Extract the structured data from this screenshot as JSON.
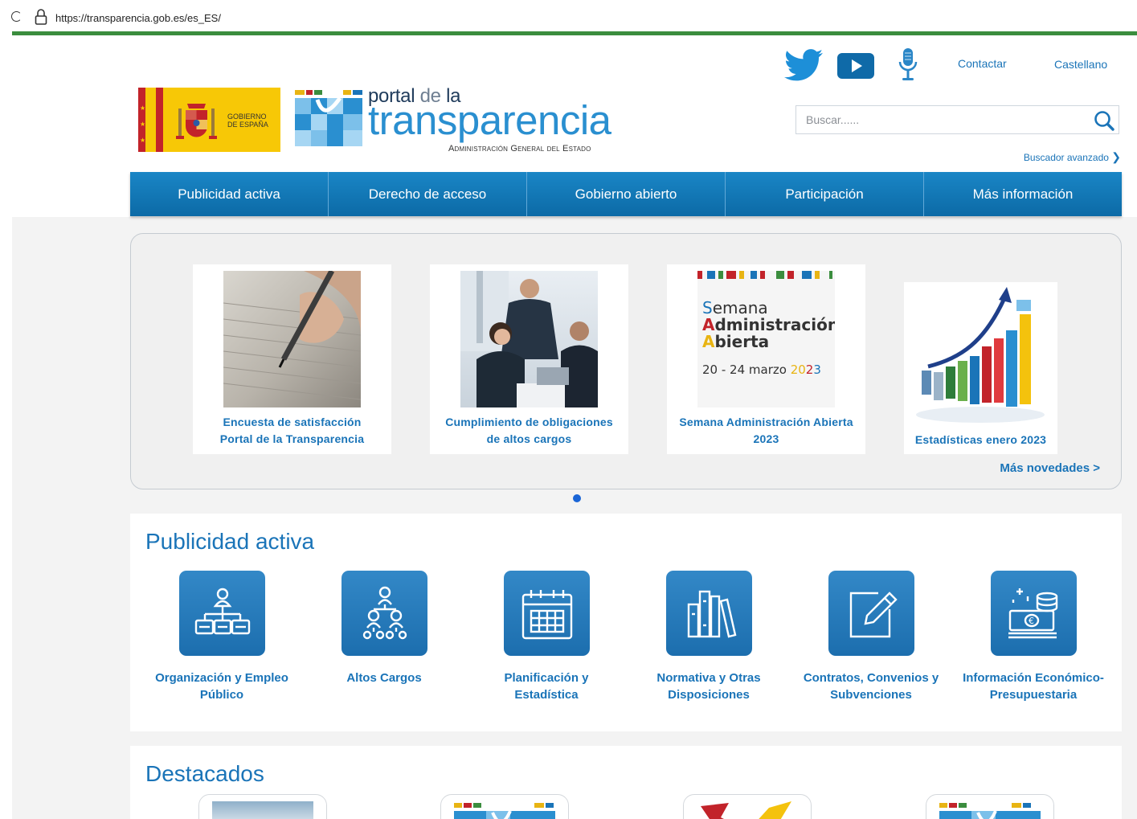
{
  "browser": {
    "url": "https://transparencia.gob.es/es_ES/",
    "load_progress": 1.0
  },
  "header": {
    "social_icons": [
      "twitter-icon",
      "youtube-icon",
      "podcast-microphone-icon"
    ],
    "contact_label": "Contactar",
    "language_label": "Castellano",
    "gobierno_logo_text": [
      "GOBIERNO",
      "DE ESPAÑA"
    ],
    "portal_logo": {
      "line1_a": "portal",
      "line1_b": "de",
      "line1_c": "la",
      "line2": "transparencia",
      "line3": "Administración General del Estado"
    },
    "search": {
      "placeholder": "Buscar......",
      "icon": "search-icon"
    },
    "advanced_search": "Buscador avanzado"
  },
  "nav": {
    "items": [
      {
        "label": "Publicidad activa"
      },
      {
        "label": "Derecho de acceso"
      },
      {
        "label": "Gobierno abierto"
      },
      {
        "label": "Participación"
      },
      {
        "label": "Más información"
      }
    ]
  },
  "carousel": {
    "cards": [
      {
        "title_line1": "Encuesta de satisfacción",
        "title_line2": "Portal de la Transparencia",
        "image": "pen-signing-document-photo"
      },
      {
        "title_line1": "Cumplimiento de obligaciones",
        "title_line2": "de altos cargos",
        "image": "office-meeting-photo"
      },
      {
        "title_line1": "Semana Administración Abierta",
        "title_line2": "2023",
        "image_text": {
          "w1_initial": "S",
          "w1_rest": "emana",
          "w2_initial": "A",
          "w2_rest": "dministración",
          "w3_initial": "A",
          "w3_rest": "bierta",
          "dates": "20 - 24 marzo ",
          "year_a": "20",
          "year_b": "2",
          "year_c": "3"
        }
      },
      {
        "title_line1": "Estadísticas enero 2023",
        "image": "bar-chart-growth-illustration"
      }
    ],
    "more_news": "Más novedades >",
    "active_page": 1
  },
  "publicidad_activa": {
    "heading": "Publicidad activa",
    "items": [
      {
        "line1": "Organización y Empleo",
        "line2": "Público",
        "icon": "org-chart-icon"
      },
      {
        "line1": "Altos Cargos",
        "line2": "",
        "icon": "hierarchy-people-icon"
      },
      {
        "line1": "Planificación y",
        "line2": "Estadística",
        "icon": "calendar-icon"
      },
      {
        "line1": "Normativa y Otras",
        "line2": "Disposiciones",
        "icon": "books-icon"
      },
      {
        "line1": "Contratos, Convenios y",
        "line2": "Subvenciones",
        "icon": "edit-document-icon"
      },
      {
        "line1": "Información Económico-",
        "line2": "Presupuestaria",
        "icon": "money-coins-icon"
      }
    ]
  },
  "destacados": {
    "heading": "Destacados"
  },
  "colors": {
    "brand_blue": "#1a74b8",
    "nav_blue": "#0c6aa6",
    "accent_green": "#3b8d3e"
  }
}
